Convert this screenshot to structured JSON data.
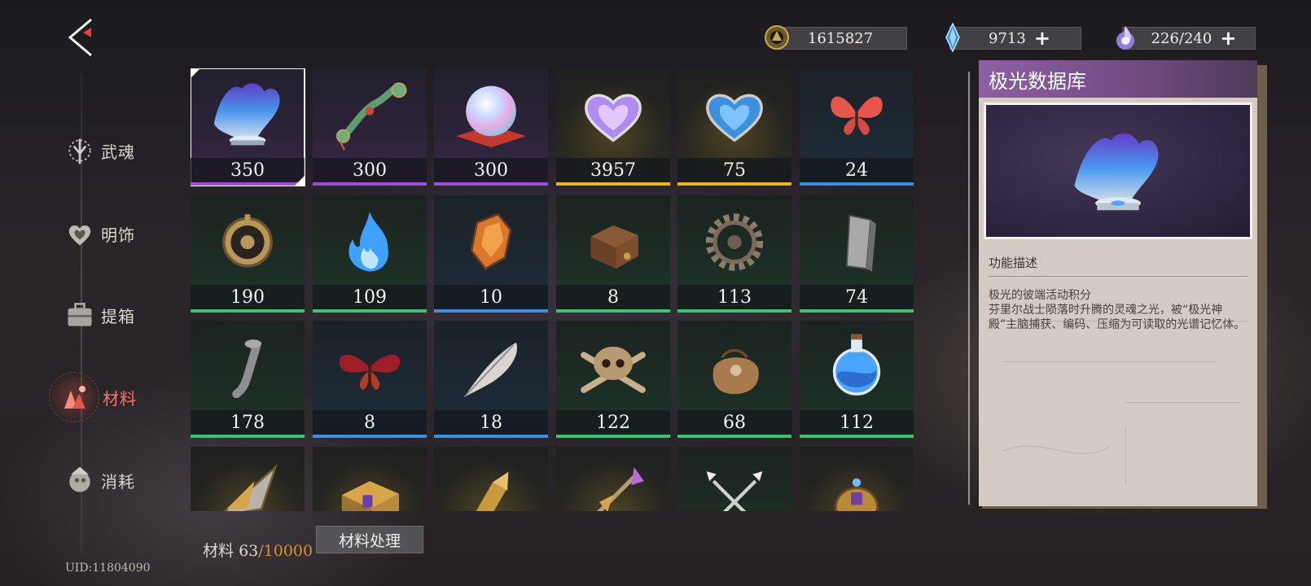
{
  "header": {
    "back_icon": "back-arrow-icon",
    "currencies": [
      {
        "name": "gold-coin",
        "icon": "coin-icon",
        "value": "1615827",
        "has_plus": false
      },
      {
        "name": "crystal",
        "icon": "blue-crystal-icon",
        "value": "9713",
        "has_plus": true
      },
      {
        "name": "stamina",
        "icon": "soul-flame-icon",
        "value": "226/240",
        "has_plus": true
      }
    ],
    "plus_symbol": "+"
  },
  "sidebar": {
    "items": [
      {
        "label": "武魂",
        "icon": "warsoul-icon",
        "active": false
      },
      {
        "label": "明饰",
        "icon": "heart-ornament-icon",
        "active": false
      },
      {
        "label": "提箱",
        "icon": "suitcase-icon",
        "active": false
      },
      {
        "label": "材料",
        "icon": "materials-icon",
        "active": true
      },
      {
        "label": "消耗",
        "icon": "consumable-icon",
        "active": false
      }
    ],
    "uid": "UID:11804090"
  },
  "grid": {
    "items": [
      {
        "name": "aurora-database",
        "icon": "aurora-hologram-icon",
        "count": "350",
        "rarity": "purple",
        "selected": true
      },
      {
        "name": "jade-ruyi",
        "icon": "jade-scepter-icon",
        "count": "300",
        "rarity": "purple"
      },
      {
        "name": "crystal-orb",
        "icon": "crystal-orb-icon",
        "count": "300",
        "rarity": "purple"
      },
      {
        "name": "purple-heart-gem",
        "icon": "purple-heart-icon",
        "count": "3957",
        "rarity": "gold"
      },
      {
        "name": "blue-heart-gem",
        "icon": "blue-heart-icon",
        "count": "75",
        "rarity": "gold"
      },
      {
        "name": "red-butterfly",
        "icon": "butterfly-icon",
        "count": "24",
        "rarity": "blue"
      },
      {
        "name": "pocket-watch",
        "icon": "pocket-watch-icon",
        "count": "190",
        "rarity": "green"
      },
      {
        "name": "blue-flame",
        "icon": "blue-flame-icon",
        "count": "109",
        "rarity": "green"
      },
      {
        "name": "amber-crystal",
        "icon": "amber-crystal-icon",
        "count": "10",
        "rarity": "blue"
      },
      {
        "name": "wooden-box",
        "icon": "wooden-box-icon",
        "count": "8",
        "rarity": "green"
      },
      {
        "name": "gear",
        "icon": "gear-icon",
        "count": "113",
        "rarity": "green"
      },
      {
        "name": "iron-ingot",
        "icon": "metal-ingot-icon",
        "count": "74",
        "rarity": "green"
      },
      {
        "name": "hook-nail",
        "icon": "hook-icon",
        "count": "178",
        "rarity": "green"
      },
      {
        "name": "red-moth",
        "icon": "moth-icon",
        "count": "8",
        "rarity": "blue"
      },
      {
        "name": "feather",
        "icon": "feather-icon",
        "count": "18",
        "rarity": "blue"
      },
      {
        "name": "skull-crossbones",
        "icon": "skull-icon",
        "count": "122",
        "rarity": "green"
      },
      {
        "name": "leather-pouch",
        "icon": "leather-pouch-icon",
        "count": "68",
        "rarity": "green"
      },
      {
        "name": "blue-potion",
        "icon": "potion-flask-icon",
        "count": "112",
        "rarity": "green"
      },
      {
        "name": "arrowhead",
        "icon": "arrowhead-icon",
        "count": "",
        "rarity": "gold"
      },
      {
        "name": "golden-box",
        "icon": "golden-chest-icon",
        "count": "",
        "rarity": "gold"
      },
      {
        "name": "golden-bullet",
        "icon": "bullet-icon",
        "count": "",
        "rarity": "gold"
      },
      {
        "name": "purple-spear",
        "icon": "spear-icon",
        "count": "",
        "rarity": "gold"
      },
      {
        "name": "crossed-blades",
        "icon": "crossed-blades-icon",
        "count": "",
        "rarity": "green"
      },
      {
        "name": "ornate-helm",
        "icon": "ornate-helm-icon",
        "count": "",
        "rarity": "gold"
      }
    ],
    "colors": {
      "purple": "#9b4fd6",
      "gold": "#e8b523",
      "blue": "#3a8ee0",
      "green": "#3cc46a"
    }
  },
  "footer": {
    "label": "材料",
    "current": "63",
    "separator": "/",
    "max": "10000",
    "process_button": "材料处理"
  },
  "detail": {
    "title": "极光数据库",
    "section": "功能描述",
    "desc_lines": [
      "极光的彼端活动积分",
      "芬里尔战士陨落时升腾的灵魂之光，被“极光神殿”主脑捕获、编码、压缩为可读取的光谱记忆体。"
    ]
  }
}
